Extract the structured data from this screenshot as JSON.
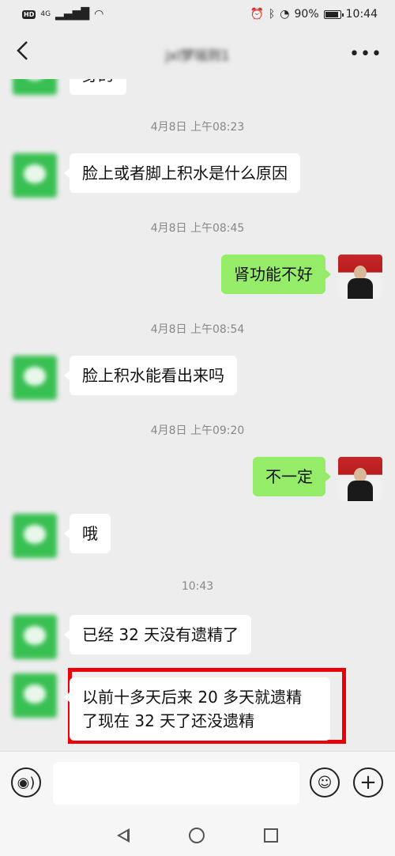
{
  "status": {
    "hd": "HD",
    "network": "4G",
    "battery": "90%",
    "time": "10:44"
  },
  "header": {
    "back_icon": "chevron-left",
    "title": "jxl梦瑶则1",
    "more_icon": "ellipsis"
  },
  "messages": {
    "partial_top": "身的",
    "ts1": "4月8日 上午08:23",
    "m1": "脸上或者脚上积水是什么原因",
    "ts2": "4月8日 上午08:45",
    "m2": "肾功能不好",
    "ts3": "4月8日 上午08:54",
    "m3": "脸上积水能看出来吗",
    "ts4": "4月8日 上午09:20",
    "m4": "不一定",
    "m5": "哦",
    "ts5": "10:43",
    "m6": "已经 32 天没有遗精了",
    "m7": "以前十多天后来 20 多天就遗精了现在 32 天了还没遗精"
  },
  "inputbar": {
    "voice_icon": "voice-icon",
    "emoji_icon": "emoji-icon",
    "add_icon": "plus-icon"
  },
  "colors": {
    "outgoing_bubble": "#95ec69",
    "incoming_bubble": "#ffffff",
    "highlight_border": "#e8000b",
    "background": "#ededed"
  }
}
